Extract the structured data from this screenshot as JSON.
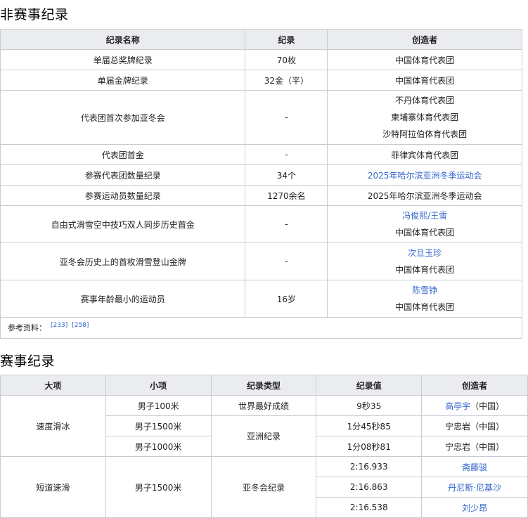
{
  "section1": {
    "title": "非赛事纪录",
    "headers": [
      "纪录名称",
      "纪录",
      "创造者"
    ],
    "rows": [
      {
        "name": "单届总奖牌纪录",
        "record": "70枚",
        "holder": [
          "中国体育代表团"
        ]
      },
      {
        "name": "单届金牌纪录",
        "record": "32金（平）",
        "holder": [
          "中国体育代表团"
        ]
      },
      {
        "name": "代表团首次参加亚冬会",
        "record": "-",
        "holder": [
          "不丹体育代表团",
          "柬埔寨体育代表团",
          "沙特阿拉伯体育代表团"
        ]
      },
      {
        "name": "代表团首金",
        "record": "-",
        "holder": [
          "菲律宾体育代表团"
        ]
      },
      {
        "name": "参赛代表团数量纪录",
        "record": "34个",
        "holder": [
          "2025年哈尔滨亚洲冬季运动会"
        ],
        "holder_link": true
      },
      {
        "name": "参赛运动员数量纪录",
        "record": "1270余名",
        "holder": [
          "2025年哈尔滨亚洲冬季运动会"
        ]
      },
      {
        "name": "自由式滑雪空中技巧双人同步历史首金",
        "record": "-",
        "holder": [
          "冯俊熙/王雪",
          "中国体育代表团"
        ]
      },
      {
        "name": "亚冬会历史上的首枚滑雪登山金牌",
        "record": "-",
        "holder": [
          "次旦玉珍",
          "中国体育代表团"
        ]
      },
      {
        "name": "赛事年龄最小的运动员",
        "record": "16岁",
        "holder": [
          "陈雪铮",
          "中国体育代表团"
        ]
      }
    ],
    "refs_label": "参考资料：",
    "refs": [
      "[233]",
      "[258]"
    ]
  },
  "section2": {
    "title": "赛事纪录",
    "headers": [
      "大项",
      "小项",
      "纪录类型",
      "纪录值",
      "创造者"
    ],
    "speed": {
      "sport": "速度滑冰",
      "e1": "男子100米",
      "t1": "世界最好成绩",
      "v1": "9秒35",
      "h1": "高亭宇",
      "c1": "（中国）",
      "e2": "男子1500米",
      "t2": "亚洲纪录",
      "v2": "1分45秒85",
      "h2": "宁忠岩（中国）",
      "e3": "男子1000米",
      "v3": "1分08秒81",
      "h3": "宁忠岩（中国）"
    },
    "short": {
      "sport": "短道速滑",
      "event": "男子1500米",
      "type": "亚冬会纪录",
      "v1": "2:16.933",
      "h1": "斋藤骏",
      "v2": "2:16.863",
      "h2": "丹尼斯·尼基沙",
      "v3": "2:16.538",
      "h3": "刘少昂"
    }
  }
}
